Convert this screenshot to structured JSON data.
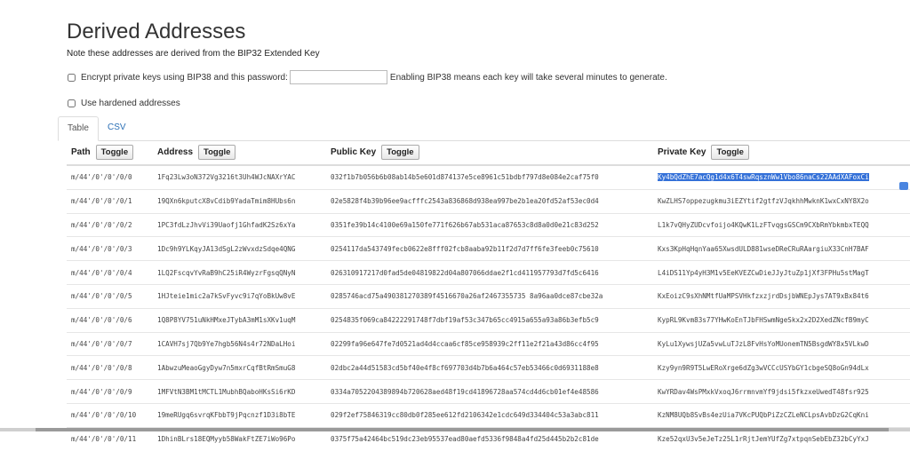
{
  "header": {
    "title": "Derived Addresses",
    "note": "Note these addresses are derived from the BIP32 Extended Key"
  },
  "options": {
    "encrypt_label": "Encrypt private keys using BIP38 and this password:",
    "password_value": "",
    "bip38_note": "Enabling BIP38 means each key will take several minutes to generate.",
    "hardened_label": "Use hardened addresses"
  },
  "tabs": [
    {
      "label": "Table",
      "active": true
    },
    {
      "label": "CSV",
      "active": false
    }
  ],
  "table": {
    "columns": [
      {
        "label": "Path",
        "toggle": "Toggle"
      },
      {
        "label": "Address",
        "toggle": "Toggle"
      },
      {
        "label": "Public Key",
        "toggle": "Toggle"
      },
      {
        "label": "Private Key",
        "toggle": "Toggle"
      }
    ],
    "rows": [
      {
        "path": "m/44'/0'/0'/0/0",
        "address": "1Fq23Lw3oN372Vg3216t3Uh4WJcNAXrYAC",
        "pub": "032f1b7b056b6b08ab14b5e601d874137e5ce8961c51bdbf797d8e084e2caf75f0",
        "priv": "Ky4bQdZhE7acQg1d4x6T4swRqsznWw1Vbo86naCs22AAdXAFoxCi"
      },
      {
        "path": "m/44'/0'/0'/0/1",
        "address": "19QXn6kputcX8vCdib9YadaTmim8HUbs6n",
        "pub": "02e5828f4b39b96ee9acfffc2543a836868d938ea997be2b1ea20fd52af53ec0d4",
        "priv": "KwZLHS7oppezugkmu3iEZYtif2gtfzVJqkhhMwknK1wxCxNY8X2o"
      },
      {
        "path": "m/44'/0'/0'/0/2",
        "address": "1PC3fdLzJhvVi39Uaofj1GhfadK2Sz6xYa",
        "pub": "0351fe39b14c4100e69a150fe771f626b67ab531aca87653c8d8a0d0e21c83d252",
        "priv": "L1k7vQHyZUDcvfoijo4KQwK1LzFTvqgsGSCm9CXbRmYbkmbxTEQQ"
      },
      {
        "path": "m/44'/0'/0'/0/3",
        "address": "1Dc9h9YLKqyJA13dSgL2zWvxdzSdqe4QNG",
        "pub": "0254117da543749fecb0622e8fff02fcb8aaba92b11f2d7d7ff6fe3feeb0c75610",
        "priv": "Kxs3KpHqHqnYaa65XwsdULD881wseDReCRuRAargiuX33CnH7BAF"
      },
      {
        "path": "m/44'/0'/0'/0/4",
        "address": "1LQ2FscqvYvRaB9hC25iR4WyzrFgsqQNyN",
        "pub": "026310917217d0fad5de04819822d04a807066ddae2f1cd411957793d7fd5c6416",
        "priv": "L4iDS11Yp4yH3M1v5EeKVEZCwDieJJyJtuZp1jXf3FPHu5stMagT"
      },
      {
        "path": "m/44'/0'/0'/0/5",
        "address": "1HJteie1mic2a7kSvFyvc9i7qYoBkUw8vE",
        "pub": "0285746acd75a490381270389f4516670a26af2467355735 8a96aa0dce87cbe32a",
        "priv": "KxEoizC9sXhNMtfUaMPSVHkfzxzjrdDsjbWNEpJys7AT9xBx84t6"
      },
      {
        "path": "m/44'/0'/0'/0/6",
        "address": "1Q8P8YV751uNkHMxeJTybA3mM1sXKv1uqM",
        "pub": "0254835f069ca84222291748f7dbf19af53c347b65cc4915a655a93a86b3efb5c9",
        "priv": "KypRL9Kvm83s77YHwKoEnTJbFHSwmNgeSkx2x2D2XedZNcfB9myC"
      },
      {
        "path": "m/44'/0'/0'/0/7",
        "address": "1CAVH7sj7Qb9Ye7hgb56N4s4r72NDaLHoi",
        "pub": "02299fa96e647fe7d0521ad4d4ccaa6cf85ce958939c2ff11e2f21a43d86cc4f95",
        "priv": "KyLu1XywsjUZa5vwLuTJzL8FvHsYoMUonemTN5BsgdWY8x5VLkwD"
      },
      {
        "path": "m/44'/0'/0'/0/8",
        "address": "1AbwzuMeaoGgyDyw7n5mxrCqfBtRmSmuG8",
        "pub": "02dbc2a44d51583cd5bf40e4f8cf697703d4b7b6a464c57eb53466c0d6931188e8",
        "priv": "Kzy9yn9R9T5LwERoXrge6dZg3wVCCcUSYbGY1cbgeSQ8oGn94dLx"
      },
      {
        "path": "m/44'/0'/0'/0/9",
        "address": "1MFVtN3BM1tMCTL1MubhBQaboHKsSi6rKD",
        "pub": "0334a7052204389894b720628aed48f19cd41896728aa574cd4d6cb01ef4e48586",
        "priv": "KwYRDav4WsPMxkVxoqJ6rrmnvmYf9jdsi5fkzxeUwedT48fsr925"
      },
      {
        "path": "m/44'/0'/0'/0/10",
        "address": "19meRUgq6svrqKFbbT9jPqcnzf1D3i8bTE",
        "pub": "029f2ef75846319cc80db0f285ee612fd2106342e1cdc649d334404c53a3abc811",
        "priv": "KzNM8UQb8SvBs4ezUia7VKcPUQbPiZzCZLeNCLpsAvbDzG2CqKni"
      },
      {
        "path": "m/44'/0'/0'/0/11",
        "address": "1DhinBLrs18EQMyyb58WakFtZE7iWo96Po",
        "pub": "0375f75a42464bc519dc23eb95537ead80aefd5336f9848a4fd25d445b2b2c81de",
        "priv": "Kze52qxU3v5eJeTz25L1rRjtJemYUfZg7xtpqnSebEbZ32bCyYxJ"
      }
    ]
  }
}
